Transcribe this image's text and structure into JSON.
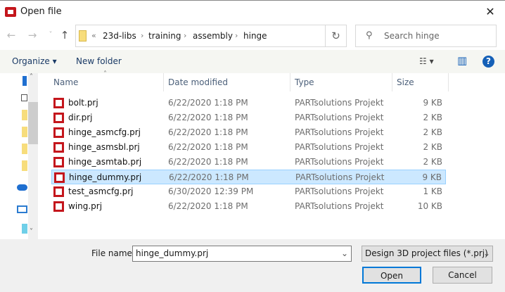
{
  "window": {
    "title": "Open file",
    "close": "✕"
  },
  "nav": {
    "back": "←",
    "forward": "→",
    "recent": "˅",
    "up": "↑",
    "refresh": "↻",
    "breadcrumb": {
      "overflow": "«",
      "items": [
        "23d-libs",
        "training",
        "assembly",
        "hinge"
      ],
      "sep": "›"
    },
    "search_placeholder": "Search hinge"
  },
  "toolbar": {
    "organize": "Organize ▾",
    "new_folder": "New folder",
    "view": "☷ ▾",
    "preview": "▥",
    "help": "?"
  },
  "navpane": {
    "scroll_position": 0.2
  },
  "columns": [
    "Name",
    "Date modified",
    "Type",
    "Size"
  ],
  "files": [
    {
      "name": "bolt.prj",
      "date": "6/22/2020 1:18 PM",
      "type": "PARTsolutions Projekt",
      "size": "9 KB"
    },
    {
      "name": "dir.prj",
      "date": "6/22/2020 1:18 PM",
      "type": "PARTsolutions Projekt",
      "size": "2 KB"
    },
    {
      "name": "hinge_asmcfg.prj",
      "date": "6/22/2020 1:18 PM",
      "type": "PARTsolutions Projekt",
      "size": "2 KB"
    },
    {
      "name": "hinge_asmsbl.prj",
      "date": "6/22/2020 1:18 PM",
      "type": "PARTsolutions Projekt",
      "size": "2 KB"
    },
    {
      "name": "hinge_asmtab.prj",
      "date": "6/22/2020 1:18 PM",
      "type": "PARTsolutions Projekt",
      "size": "2 KB"
    },
    {
      "name": "hinge_dummy.prj",
      "date": "6/22/2020 1:18 PM",
      "type": "PARTsolutions Projekt",
      "size": "9 KB",
      "selected": true
    },
    {
      "name": "test_asmcfg.prj",
      "date": "6/30/2020 12:39 PM",
      "type": "PARTsolutions Projekt",
      "size": "1 KB"
    },
    {
      "name": "wing.prj",
      "date": "6/22/2020 1:18 PM",
      "type": "PARTsolutions Projekt",
      "size": "10 KB"
    }
  ],
  "footer": {
    "file_name_label": "File name:",
    "file_name": "hinge_dummy.prj",
    "filter": "Design 3D project files (*.prj)",
    "chevron": "⌄",
    "open": "Open",
    "cancel": "Cancel"
  },
  "colors": {
    "accent": "#0078d7",
    "selection": "#cce8ff",
    "file_icon": "#c4161c"
  }
}
